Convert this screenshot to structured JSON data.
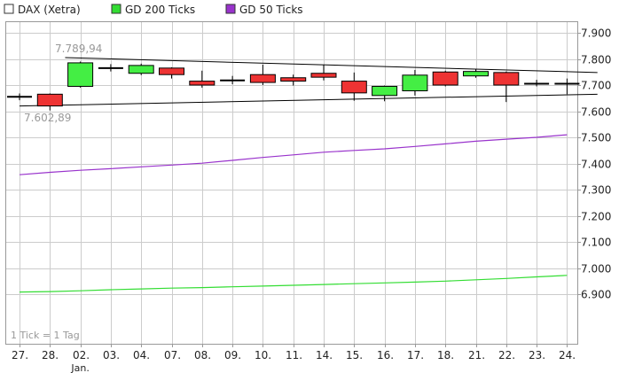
{
  "legend": {
    "items": [
      {
        "label": "DAX (Xetra)",
        "color": "#ffffff"
      },
      {
        "label": "GD 200 Ticks",
        "color": "#33dd33"
      },
      {
        "label": "GD 50 Ticks",
        "color": "#9933cc"
      }
    ]
  },
  "footnote": "1 Tick = 1 Tag",
  "annotations": {
    "high": "7.789,94",
    "low": "7.602,89"
  },
  "colors": {
    "up": "#44ee44",
    "down": "#ee3333",
    "gd200": "#33dd33",
    "gd50": "#9933cc",
    "grid": "#cccccc"
  },
  "chart_data": {
    "type": "candlestick",
    "title": "",
    "ylim": [
      6800,
      7950
    ],
    "y_ticks": [
      6900,
      7000,
      7100,
      7200,
      7300,
      7400,
      7500,
      7600,
      7700,
      7800,
      7900
    ],
    "y_tick_labels": [
      "6.900",
      "7.000",
      "7.100",
      "7.200",
      "7.300",
      "7.400",
      "7.500",
      "7.600",
      "7.700",
      "7.800",
      "7.900"
    ],
    "x_tick_labels": [
      "27.",
      "28.",
      "02.",
      "03.",
      "04.",
      "07.",
      "08.",
      "09.",
      "10.",
      "11.",
      "14.",
      "15.",
      "16.",
      "17.",
      "18.",
      "21.",
      "22.",
      "23.",
      "24."
    ],
    "x_sub_label": {
      "index": 2,
      "text": "Jan."
    },
    "grid": true,
    "legend_position": "top-left",
    "candles": [
      {
        "open": 7655,
        "close": 7655,
        "high": 7668,
        "low": 7642
      },
      {
        "open": 7665,
        "close": 7620,
        "high": 7668,
        "low": 7603
      },
      {
        "open": 7695,
        "close": 7785,
        "high": 7790,
        "low": 7690
      },
      {
        "open": 7765,
        "close": 7765,
        "high": 7780,
        "low": 7752
      },
      {
        "open": 7745,
        "close": 7775,
        "high": 7782,
        "low": 7738
      },
      {
        "open": 7765,
        "close": 7740,
        "high": 7768,
        "low": 7725
      },
      {
        "open": 7715,
        "close": 7700,
        "high": 7755,
        "low": 7690
      },
      {
        "open": 7718,
        "close": 7718,
        "high": 7735,
        "low": 7703
      },
      {
        "open": 7740,
        "close": 7710,
        "high": 7778,
        "low": 7700
      },
      {
        "open": 7728,
        "close": 7715,
        "high": 7740,
        "low": 7698
      },
      {
        "open": 7745,
        "close": 7730,
        "high": 7778,
        "low": 7718
      },
      {
        "open": 7715,
        "close": 7670,
        "high": 7748,
        "low": 7640
      },
      {
        "open": 7660,
        "close": 7695,
        "high": 7698,
        "low": 7638
      },
      {
        "open": 7678,
        "close": 7738,
        "high": 7758,
        "low": 7660
      },
      {
        "open": 7750,
        "close": 7700,
        "high": 7755,
        "low": 7695
      },
      {
        "open": 7735,
        "close": 7752,
        "high": 7760,
        "low": 7728
      },
      {
        "open": 7748,
        "close": 7700,
        "high": 7752,
        "low": 7635
      },
      {
        "open": 7705,
        "close": 7705,
        "high": 7720,
        "low": 7695
      },
      {
        "open": 7705,
        "close": 7705,
        "high": 7725,
        "low": 7665
      }
    ],
    "series": [
      {
        "name": "GD 200 Ticks",
        "values": [
          6908,
          6910,
          6913,
          6917,
          6920,
          6923,
          6925,
          6928,
          6931,
          6934,
          6937,
          6940,
          6943,
          6946,
          6950,
          6955,
          6960,
          6966,
          6972
        ]
      },
      {
        "name": "GD 50 Ticks",
        "values": [
          7357,
          7366,
          7374,
          7380,
          7387,
          7394,
          7401,
          7412,
          7423,
          7433,
          7443,
          7450,
          7456,
          7465,
          7475,
          7485,
          7493,
          7500,
          7510
        ]
      }
    ],
    "trendlines": [
      {
        "x_start": 0,
        "y_start": 7620,
        "x_end": 19,
        "y_end": 7665
      },
      {
        "x_start": 1.5,
        "y_start": 7805,
        "x_end": 19,
        "y_end": 7748
      }
    ]
  }
}
